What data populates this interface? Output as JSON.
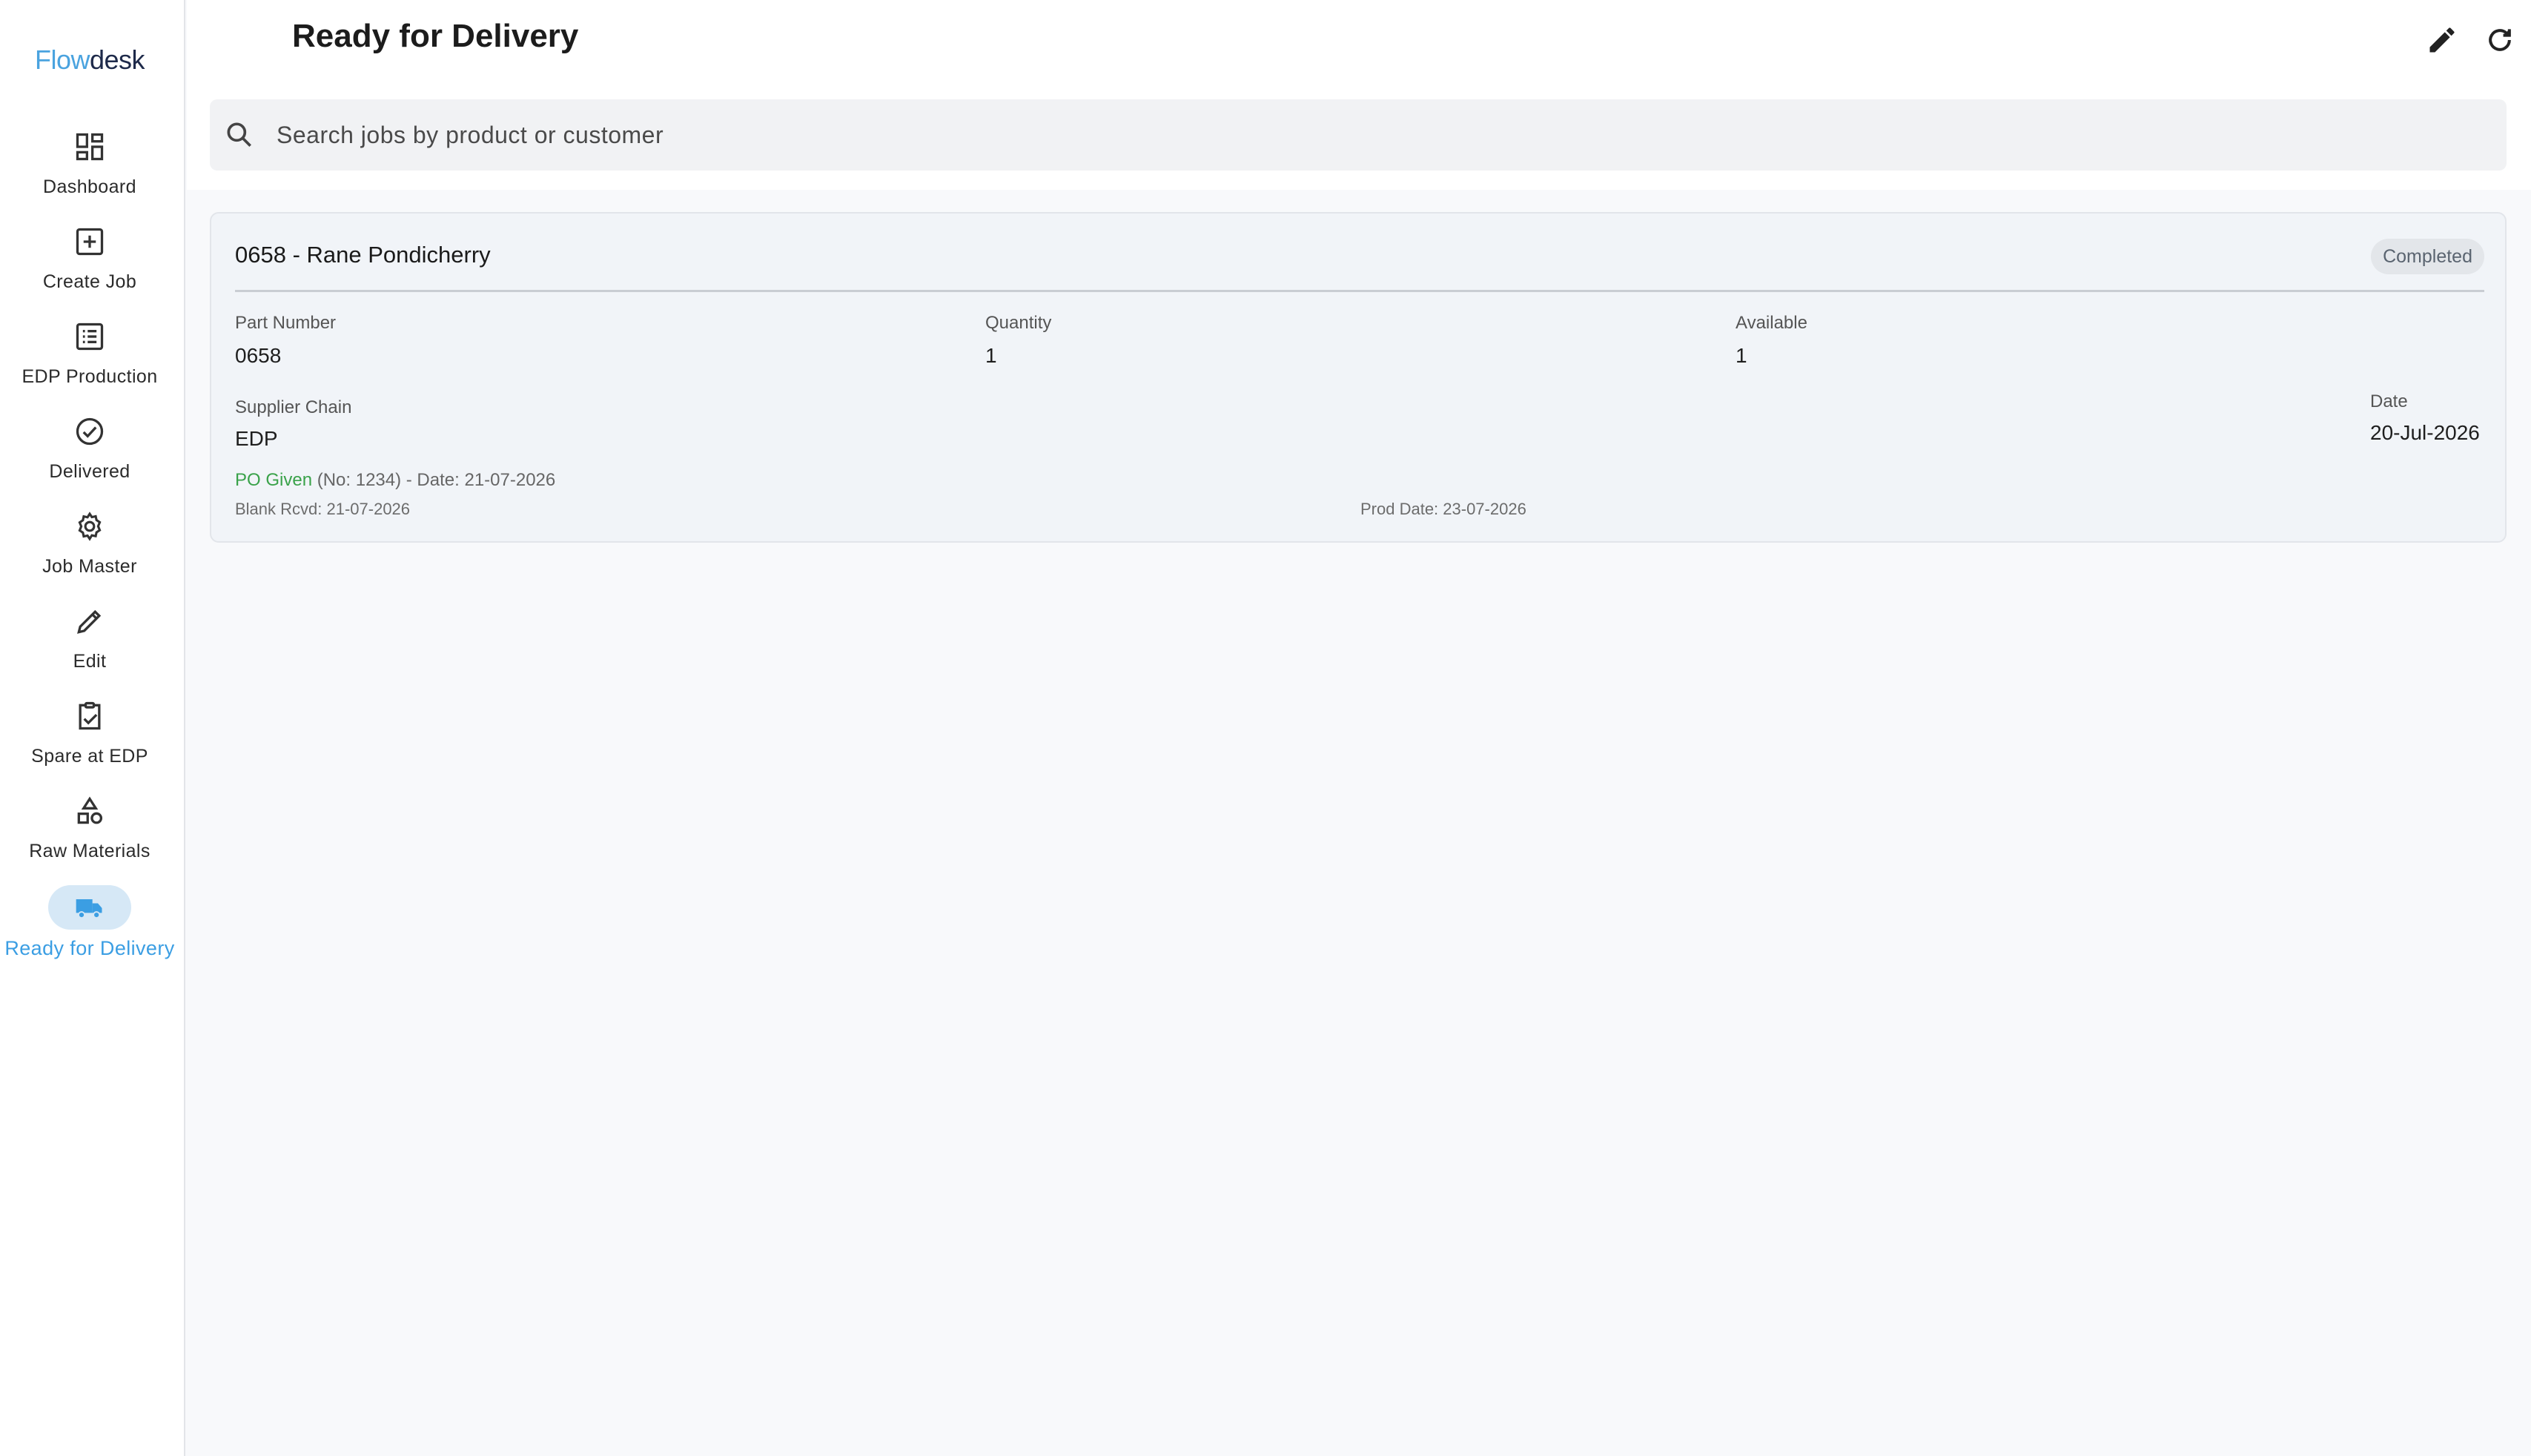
{
  "brand": {
    "part1": "Flow",
    "part2": "desk"
  },
  "sidebar": {
    "items": [
      {
        "label": "Dashboard",
        "icon": "dashboard-icon"
      },
      {
        "label": "Create Job",
        "icon": "add-box-icon"
      },
      {
        "label": "EDP Production",
        "icon": "list-icon"
      },
      {
        "label": "Delivered",
        "icon": "check-circle-icon"
      },
      {
        "label": "Job Master",
        "icon": "gear-icon"
      },
      {
        "label": "Edit",
        "icon": "pencil-icon"
      },
      {
        "label": "Spare at EDP",
        "icon": "clipboard-check-icon"
      },
      {
        "label": "Raw Materials",
        "icon": "shapes-icon"
      },
      {
        "label": "Ready for Delivery",
        "icon": "truck-icon",
        "active": true
      }
    ]
  },
  "header": {
    "title": "Ready for Delivery"
  },
  "search": {
    "placeholder": "Search jobs by product or customer",
    "value": ""
  },
  "job": {
    "title": "0658 - Rane Pondicherry",
    "status": "Completed",
    "part_number_label": "Part Number",
    "part_number": "0658",
    "quantity_label": "Quantity",
    "quantity": "1",
    "available_label": "Available",
    "available": "1",
    "supplier_label": "Supplier Chain",
    "supplier": "EDP",
    "date_label": "Date",
    "date": "20-Jul-2026",
    "po_status": "PO Given",
    "po_details": " (No: 1234) - Date: 21-07-2026",
    "blank_rcvd": "Blank Rcvd: 21-07-2026",
    "prod_date": "Prod Date: 23-07-2026"
  },
  "colors": {
    "accent": "#3b9ee3",
    "active_pill": "#d6e8f6",
    "po_green": "#3aa24a"
  }
}
